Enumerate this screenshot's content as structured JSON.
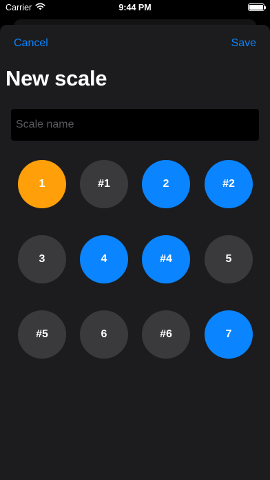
{
  "status_bar": {
    "carrier": "Carrier",
    "time": "9:44 PM",
    "icons": [
      "wifi-icon",
      "battery-icon"
    ]
  },
  "nav": {
    "cancel_label": "Cancel",
    "save_label": "Save"
  },
  "title": "New scale",
  "scale_name": {
    "value": "",
    "placeholder": "Scale name"
  },
  "colors": {
    "accent": "#0a84ff",
    "tonic": "#ff9f0a",
    "selected": "#0a84ff",
    "unselected": "#3a3a3c",
    "sheet": "#1c1c1e",
    "input": "#000000"
  },
  "notes": [
    {
      "label": "1",
      "state": "tonic"
    },
    {
      "label": "#1",
      "state": "unselected"
    },
    {
      "label": "2",
      "state": "selected"
    },
    {
      "label": "#2",
      "state": "selected"
    },
    {
      "label": "3",
      "state": "unselected"
    },
    {
      "label": "4",
      "state": "selected"
    },
    {
      "label": "#4",
      "state": "selected"
    },
    {
      "label": "5",
      "state": "unselected"
    },
    {
      "label": "#5",
      "state": "unselected"
    },
    {
      "label": "6",
      "state": "unselected"
    },
    {
      "label": "#6",
      "state": "unselected"
    },
    {
      "label": "7",
      "state": "selected"
    }
  ]
}
